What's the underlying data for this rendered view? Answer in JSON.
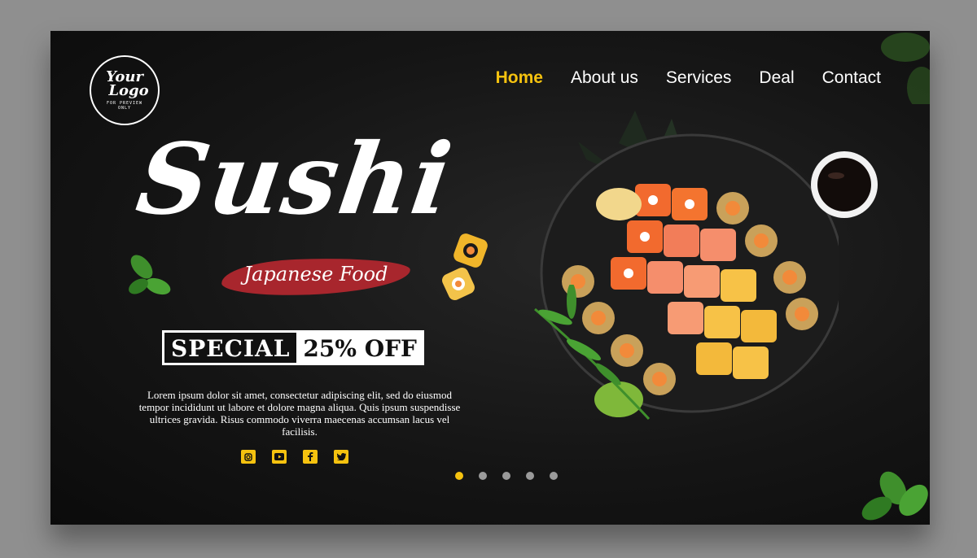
{
  "logo": {
    "line1": "Your",
    "line2": "Logo",
    "tagline": "FOR PREVIEW ONLY"
  },
  "nav": {
    "items": [
      {
        "label": "Home",
        "active": true
      },
      {
        "label": "About us",
        "active": false
      },
      {
        "label": "Services",
        "active": false
      },
      {
        "label": "Deal",
        "active": false
      },
      {
        "label": "Contact",
        "active": false
      }
    ]
  },
  "hero": {
    "title": "Sushi",
    "subtitle": "Japanese Food"
  },
  "promo": {
    "label": "SPECIAL",
    "discount": "25% OFF"
  },
  "description": "Lorem ipsum dolor sit amet, consectetur adipiscing elit, sed do eiusmod tempor incididunt ut labore et dolore magna aliqua. Quis ipsum suspendisse ultrices gravida. Risus commodo viverra maecenas accumsan lacus vel facilisis.",
  "social": [
    "instagram-icon",
    "youtube-icon",
    "facebook-icon",
    "twitter-icon"
  ],
  "carousel": {
    "count": 5,
    "active_index": 0
  },
  "colors": {
    "accent": "#f5c20f",
    "brush": "#a8262d",
    "background": "#151515"
  }
}
